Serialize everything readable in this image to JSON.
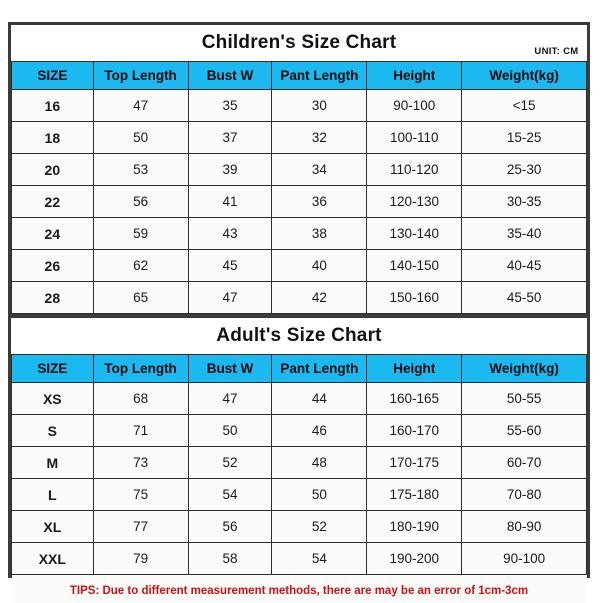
{
  "unit_note": "UNIT: CM",
  "columns": [
    "SIZE",
    "Top Length",
    "Bust W",
    "Pant Length",
    "Height",
    "Weight(kg)"
  ],
  "children": {
    "title": "Children's Size Chart",
    "rows": [
      [
        "16",
        "47",
        "35",
        "30",
        "90-100",
        "<15"
      ],
      [
        "18",
        "50",
        "37",
        "32",
        "100-110",
        "15-25"
      ],
      [
        "20",
        "53",
        "39",
        "34",
        "110-120",
        "25-30"
      ],
      [
        "22",
        "56",
        "41",
        "36",
        "120-130",
        "30-35"
      ],
      [
        "24",
        "59",
        "43",
        "38",
        "130-140",
        "35-40"
      ],
      [
        "26",
        "62",
        "45",
        "40",
        "140-150",
        "40-45"
      ],
      [
        "28",
        "65",
        "47",
        "42",
        "150-160",
        "45-50"
      ]
    ]
  },
  "adult": {
    "title": "Adult's Size Chart",
    "rows": [
      [
        "XS",
        "68",
        "47",
        "44",
        "160-165",
        "50-55"
      ],
      [
        "S",
        "71",
        "50",
        "46",
        "160-170",
        "55-60"
      ],
      [
        "M",
        "73",
        "52",
        "48",
        "170-175",
        "60-70"
      ],
      [
        "L",
        "75",
        "54",
        "50",
        "175-180",
        "70-80"
      ],
      [
        "XL",
        "77",
        "56",
        "52",
        "180-190",
        "80-90"
      ],
      [
        "XXL",
        "79",
        "58",
        "54",
        "190-200",
        "90-100"
      ]
    ]
  },
  "tips": "TIPS: Due to different measurement methods, there are may be an error of 1cm-3cm",
  "colors": {
    "header_blue": "#1cb8f0",
    "cell_bg": "#fafaf8",
    "border": "#2e2e2e",
    "tips_red": "#cc1111"
  }
}
